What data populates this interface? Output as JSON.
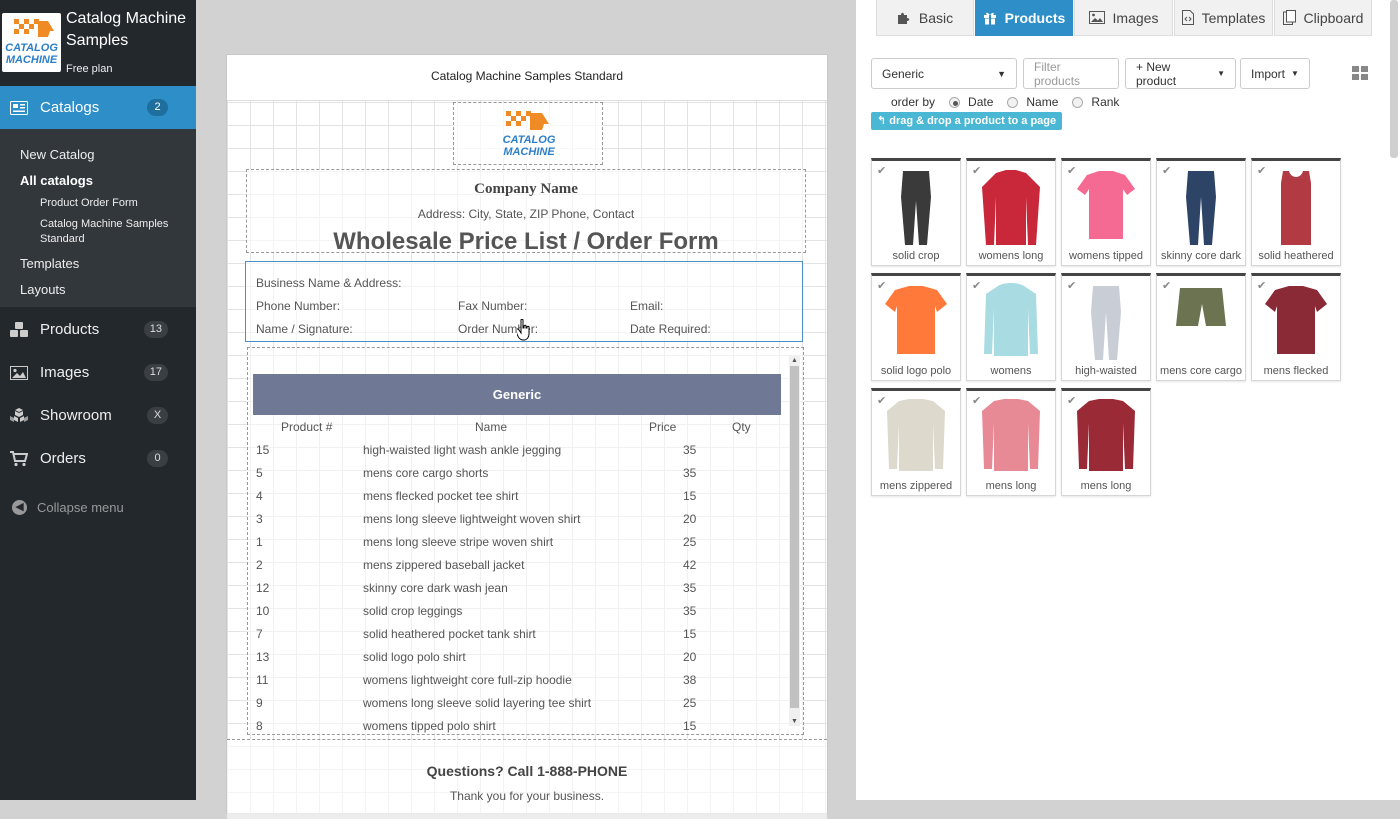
{
  "brand": {
    "title": "Catalog Machine Samples",
    "plan": "Free plan",
    "logo_text_1": "CATALOG",
    "logo_text_2": "MACHINE"
  },
  "nav": {
    "catalogs": {
      "label": "Catalogs",
      "count": "2"
    },
    "sub": {
      "new_catalog": "New Catalog",
      "all_catalogs": "All catalogs",
      "product_order_form": "Product Order Form",
      "samples_standard": "Catalog Machine Samples Standard",
      "templates": "Templates",
      "layouts": "Layouts"
    },
    "products": {
      "label": "Products",
      "count": "13"
    },
    "images": {
      "label": "Images",
      "count": "17"
    },
    "showroom": {
      "label": "Showroom",
      "count": "X"
    },
    "orders": {
      "label": "Orders",
      "count": "0"
    },
    "collapse": "Collapse menu"
  },
  "page": {
    "header": "Catalog Machine Samples Standard",
    "company_name": "Company Name",
    "address": "Address: City, State, ZIP Phone, Contact",
    "form_title": "Wholesale Price List / Order Form",
    "order_fields": {
      "business": "Business Name & Address:",
      "phone": "Phone Number:",
      "fax": "Fax Number:",
      "email": "Email:",
      "signature": "Name / Signature:",
      "order_number": "Order Number:",
      "date_required": "Date Required:"
    },
    "table": {
      "title": "Generic",
      "columns": [
        "Product #",
        "Name",
        "Price",
        "Qty"
      ],
      "rows": [
        {
          "num": "15",
          "name": "high-waisted light wash ankle jegging",
          "price": "35"
        },
        {
          "num": "5",
          "name": "mens core cargo shorts",
          "price": "35"
        },
        {
          "num": "4",
          "name": "mens flecked pocket tee shirt",
          "price": "15"
        },
        {
          "num": "3",
          "name": "mens long sleeve lightweight woven shirt",
          "price": "20"
        },
        {
          "num": "1",
          "name": "mens long sleeve stripe woven shirt",
          "price": "25"
        },
        {
          "num": "2",
          "name": "mens zippered baseball jacket",
          "price": "42"
        },
        {
          "num": "12",
          "name": "skinny core dark wash jean",
          "price": "35"
        },
        {
          "num": "10",
          "name": "solid crop leggings",
          "price": "35"
        },
        {
          "num": "7",
          "name": "solid heathered pocket tank shirt",
          "price": "15"
        },
        {
          "num": "13",
          "name": "solid logo polo shirt",
          "price": "20"
        },
        {
          "num": "11",
          "name": "womens lightweight core full-zip hoodie",
          "price": "38"
        },
        {
          "num": "9",
          "name": "womens long sleeve solid layering tee shirt",
          "price": "25"
        },
        {
          "num": "8",
          "name": "womens tipped polo shirt",
          "price": "15"
        }
      ]
    },
    "footer_question": "Questions? Call 1-888-PHONE",
    "footer_thanks": "Thank you for your business."
  },
  "panel": {
    "tabs": [
      {
        "label": "Basic",
        "icon": "puzzle-icon"
      },
      {
        "label": "Products",
        "icon": "gift-icon"
      },
      {
        "label": "Images",
        "icon": "image-icon"
      },
      {
        "label": "Templates",
        "icon": "code-file-icon"
      },
      {
        "label": "Clipboard",
        "icon": "clipboard-icon"
      }
    ],
    "category_select": "Generic",
    "filter_placeholder": "Filter products",
    "new_product": "+ New product",
    "import": "Import",
    "order_by_label": "order by",
    "order_options": [
      "Date",
      "Name",
      "Rank"
    ],
    "order_selected": "Date",
    "drag_hint": "drag & drop a product to a page",
    "products": [
      {
        "caption": "solid crop",
        "color": "#3a3a3a"
      },
      {
        "caption": "womens long",
        "color": "#c8283a"
      },
      {
        "caption": "womens tipped",
        "color": "#f46a92"
      },
      {
        "caption": "skinny core dark",
        "color": "#2e4466"
      },
      {
        "caption": "solid heathered",
        "color": "#b23a42"
      },
      {
        "caption": "solid logo polo",
        "color": "#ff7a3a"
      },
      {
        "caption": "womens",
        "color": "#a8dbe2"
      },
      {
        "caption": "high-waisted",
        "color": "#c9cdd6"
      },
      {
        "caption": "mens core cargo",
        "color": "#6b7350"
      },
      {
        "caption": "mens flecked",
        "color": "#8a2a36"
      },
      {
        "caption": "mens zippered",
        "color": "#ddd9cc"
      },
      {
        "caption": "mens long",
        "color": "#e88a96"
      },
      {
        "caption": "mens long",
        "color": "#9a2a36"
      }
    ]
  }
}
